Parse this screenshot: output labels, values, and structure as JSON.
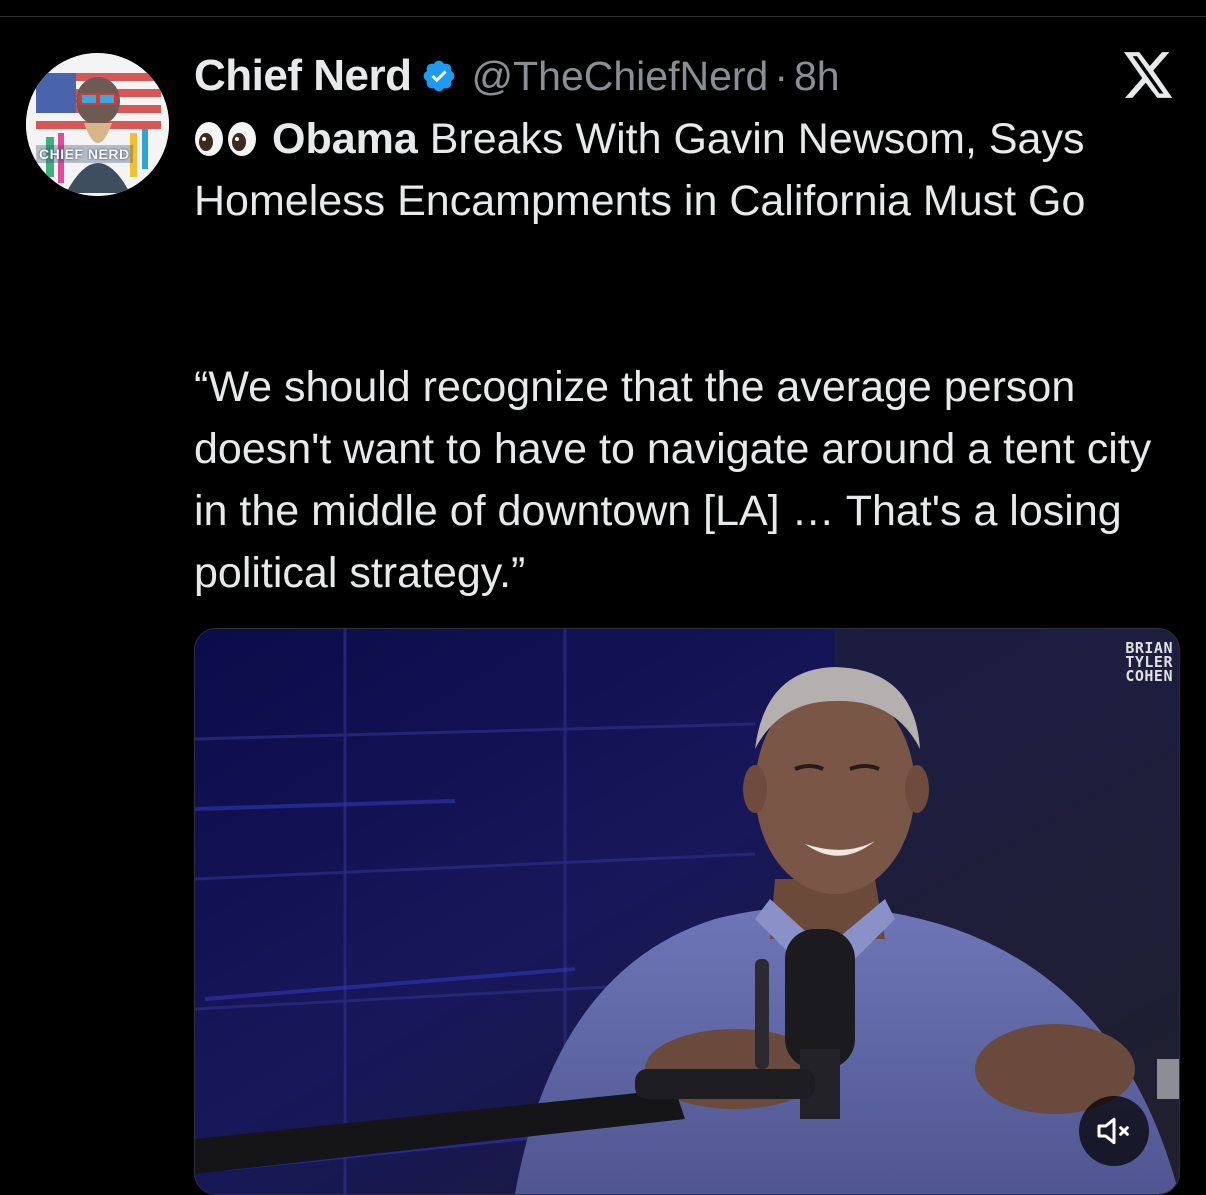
{
  "author": {
    "display_name": "Chief Nerd",
    "handle": "@TheChiefNerd",
    "separator": "·",
    "time": "8h",
    "avatar_label": "CHIEF NERD",
    "verified_color": "#1d9bf0"
  },
  "tweet": {
    "emoji": "👀",
    "bold_lead": "Obama",
    "headline_rest": " Breaks With Gavin Newsom, Says Homeless Encampments in California Must Go",
    "quote": "“We should recognize that the average person doesn't want to have to navigate around a tent city in the middle of downtown [LA] … That's a losing political strategy.”"
  },
  "media": {
    "watermark_lines": [
      "BRIAN",
      "TYLER",
      "COHEN"
    ],
    "mute_icon": "speaker-muted-icon"
  },
  "colors": {
    "background": "#000000",
    "text": "#e7e9ea",
    "secondary_text": "#8b8f94",
    "accent": "#1d9bf0"
  }
}
